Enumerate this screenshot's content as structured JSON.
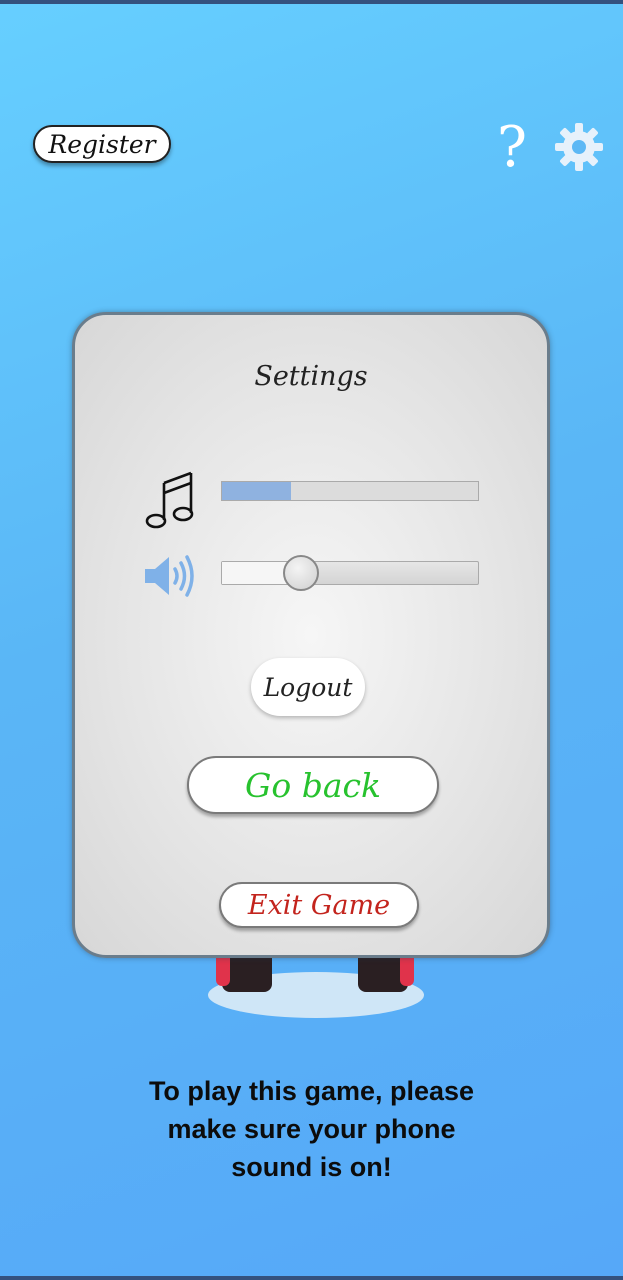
{
  "header": {
    "register_label": "Register",
    "help_symbol": "?",
    "settings_icon": "gear-icon"
  },
  "settings_panel": {
    "title": "Settings",
    "music_volume_percent": 27,
    "sound_volume_percent": 31,
    "logout_label": "Logout",
    "go_back_label": "Go back",
    "exit_game_label": "Exit Game"
  },
  "footer": {
    "sound_notice": "To play this game, please\nmake sure your phone\nsound is on!"
  },
  "colors": {
    "go_back_text": "#27c22e",
    "exit_game_text": "#c3241d",
    "music_fill": "#8fb2e0"
  }
}
